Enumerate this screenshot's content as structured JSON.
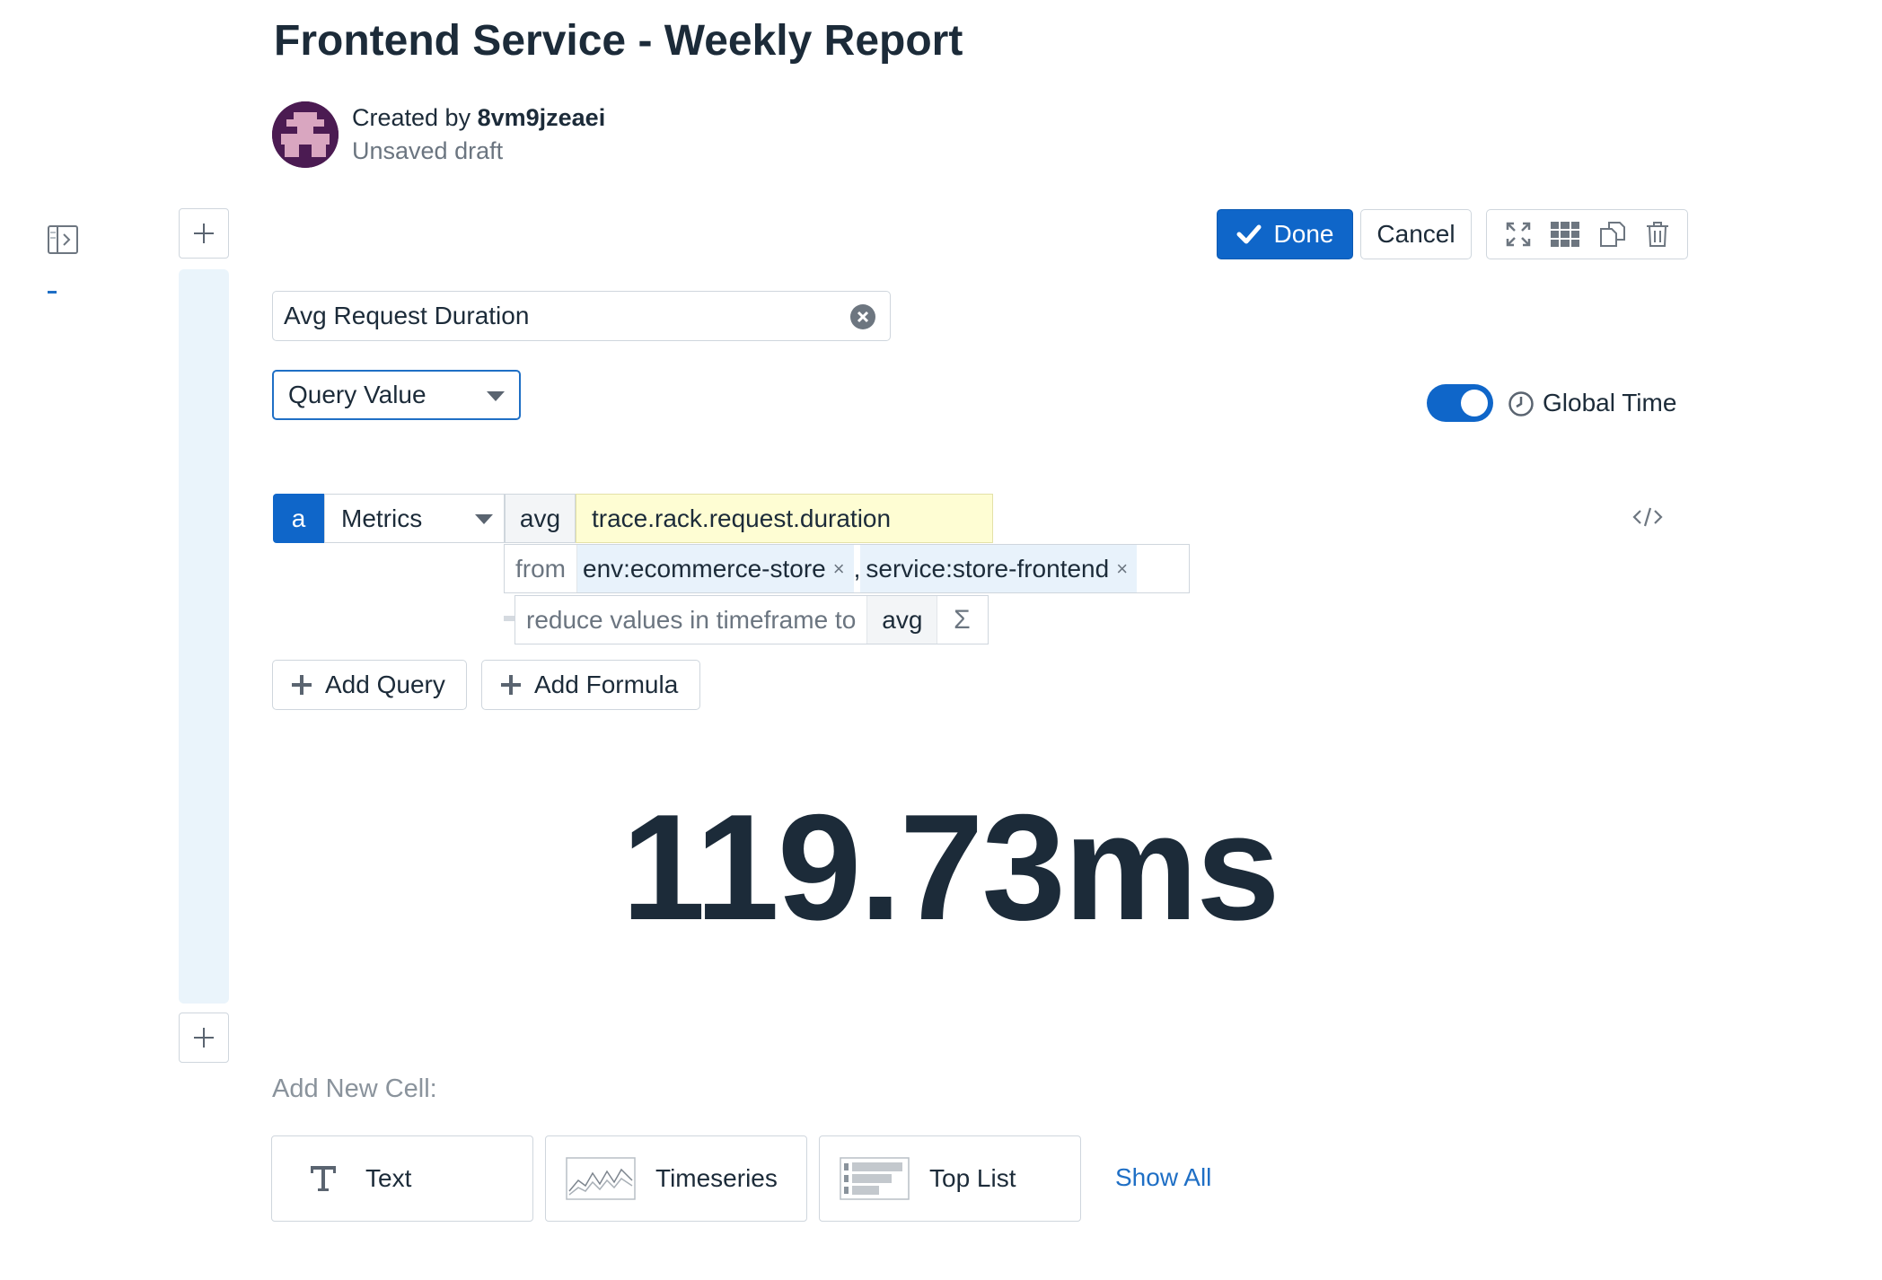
{
  "header": {
    "title": "Frontend Service - Weekly Report",
    "created_prefix": "Created by",
    "author": "8vm9jzeaei",
    "status": "Unsaved draft"
  },
  "toolbar": {
    "done_label": "Done",
    "cancel_label": "Cancel",
    "icons": [
      "expand-icon",
      "grid-icon",
      "clone-icon",
      "trash-icon"
    ]
  },
  "widget": {
    "title": "Avg Request Duration",
    "visualization": "Query Value",
    "global_time_label": "Global Time",
    "global_time_enabled": true
  },
  "query": {
    "letter": "a",
    "source": "Metrics",
    "aggregator": "avg",
    "metric": "trace.rack.request.duration",
    "from_label": "from",
    "tags": [
      "env:ecommerce-store",
      "service:store-frontend"
    ],
    "tag_separator": ",",
    "tag_remove": "×",
    "reduce_label": "reduce values in timeframe to",
    "reduce_aggregator": "avg",
    "function_symbol": "Σ"
  },
  "actions": {
    "add_query": "Add Query",
    "add_formula": "Add Formula"
  },
  "result": {
    "value": "119.73ms"
  },
  "add_cell": {
    "label": "Add New Cell:",
    "types": [
      "Text",
      "Timeseries",
      "Top List"
    ],
    "show_all": "Show All"
  },
  "colors": {
    "accent": "#0f66c9",
    "text": "#1c2b39",
    "metric_highlight": "#fefdd3",
    "tag_bg": "#e8f2fb",
    "rail": "#eaf4fb"
  }
}
